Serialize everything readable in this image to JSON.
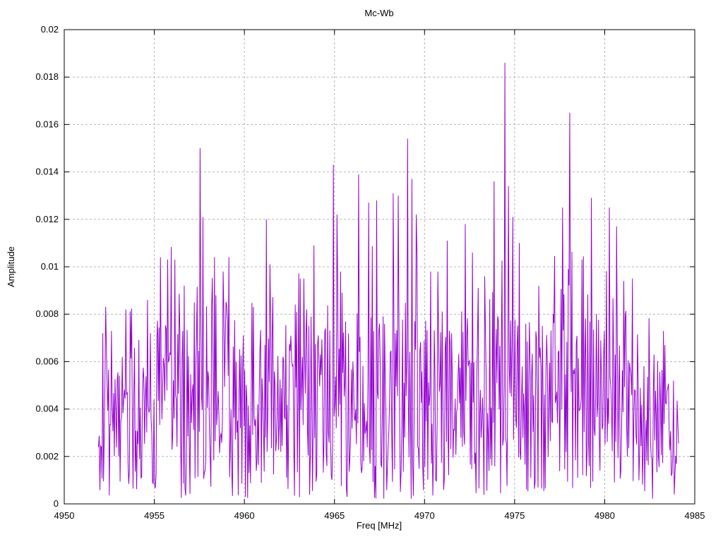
{
  "window": {
    "background": "#ffffff"
  },
  "chart_data": {
    "type": "line",
    "title": "Mc-Wb",
    "xlabel": "Freq [MHz]",
    "ylabel": "Amplitude",
    "xlim": [
      4950,
      4985
    ],
    "ylim": [
      0,
      0.02
    ],
    "x_ticks": [
      4950,
      4955,
      4960,
      4965,
      4970,
      4975,
      4980,
      4985
    ],
    "x_tick_labels": [
      "4950",
      "4955",
      "4960",
      "4965",
      "4970",
      "4975",
      "4980",
      "4985"
    ],
    "y_ticks": [
      0,
      0.002,
      0.004,
      0.006,
      0.008,
      0.01,
      0.012,
      0.014,
      0.016,
      0.018,
      0.02
    ],
    "y_tick_labels": [
      "0",
      "0.002",
      "0.004",
      "0.006",
      "0.008",
      "0.01",
      "0.012",
      "0.014",
      "0.016",
      "0.018",
      "0.02"
    ],
    "grid": "dashed",
    "grid_color": "#b5b5b5",
    "axis_color": "#000000",
    "legend": "none",
    "series": [
      {
        "name": "Mc-Wb",
        "color": "#9400D3",
        "style": "lines",
        "x_start": 4951.9,
        "x_end": 4984.1,
        "x_step": 0.04,
        "noise_floor": 0.0002,
        "seed": 11,
        "spike_probability": 0.07,
        "spike_gain": 0.3,
        "band_envelope": [
          [
            4951.9,
            0.0045
          ],
          [
            4952.3,
            0.0068
          ],
          [
            4953.0,
            0.006
          ],
          [
            4953.6,
            0.0072
          ],
          [
            4954.5,
            0.007
          ],
          [
            4955.2,
            0.0078
          ],
          [
            4956.0,
            0.0085
          ],
          [
            4957.0,
            0.007
          ],
          [
            4957.8,
            0.0075
          ],
          [
            4958.8,
            0.0085
          ],
          [
            4959.6,
            0.0078
          ],
          [
            4960.4,
            0.0072
          ],
          [
            4961.2,
            0.0078
          ],
          [
            4962.2,
            0.0068
          ],
          [
            4963.0,
            0.0075
          ],
          [
            4964.0,
            0.0082
          ],
          [
            4965.0,
            0.0085
          ],
          [
            4966.0,
            0.0078
          ],
          [
            4967.0,
            0.0085
          ],
          [
            4968.0,
            0.0082
          ],
          [
            4969.0,
            0.0088
          ],
          [
            4970.0,
            0.0078
          ],
          [
            4971.0,
            0.0075
          ],
          [
            4972.0,
            0.0082
          ],
          [
            4973.0,
            0.0078
          ],
          [
            4974.0,
            0.0082
          ],
          [
            4975.0,
            0.0082
          ],
          [
            4976.0,
            0.0078
          ],
          [
            4977.0,
            0.0082
          ],
          [
            4978.0,
            0.0085
          ],
          [
            4979.0,
            0.0082
          ],
          [
            4980.0,
            0.0082
          ],
          [
            4981.0,
            0.0085
          ],
          [
            4982.0,
            0.0078
          ],
          [
            4982.8,
            0.0065
          ],
          [
            4983.4,
            0.0058
          ],
          [
            4983.8,
            0.0045
          ],
          [
            4984.1,
            0.0035
          ]
        ],
        "peaks": [
          [
            4952.15,
            0.0072
          ],
          [
            4953.4,
            0.0082
          ],
          [
            4954.6,
            0.0086
          ],
          [
            4955.35,
            0.0104
          ],
          [
            4955.75,
            0.0103
          ],
          [
            4956.15,
            0.0103
          ],
          [
            4956.65,
            0.0092
          ],
          [
            4957.55,
            0.015
          ],
          [
            4957.7,
            0.0121
          ],
          [
            4958.35,
            0.0104
          ],
          [
            4958.8,
            0.0098
          ],
          [
            4959.15,
            0.0104
          ],
          [
            4960.5,
            0.0083
          ],
          [
            4961.2,
            0.012
          ],
          [
            4961.4,
            0.0101
          ],
          [
            4963.3,
            0.0095
          ],
          [
            4963.85,
            0.0109
          ],
          [
            4964.95,
            0.0143
          ],
          [
            4965.15,
            0.0122
          ],
          [
            4965.35,
            0.0098
          ],
          [
            4966.35,
            0.0139
          ],
          [
            4966.9,
            0.0127
          ],
          [
            4967.35,
            0.0128
          ],
          [
            4968.25,
            0.0131
          ],
          [
            4968.55,
            0.013
          ],
          [
            4969.05,
            0.0154
          ],
          [
            4969.3,
            0.0137
          ],
          [
            4969.55,
            0.0122
          ],
          [
            4970.35,
            0.0098
          ],
          [
            4970.75,
            0.0098
          ],
          [
            4971.25,
            0.0111
          ],
          [
            4972.25,
            0.0118
          ],
          [
            4972.65,
            0.0106
          ],
          [
            4973.35,
            0.0096
          ],
          [
            4973.85,
            0.0136
          ],
          [
            4974.45,
            0.0186
          ],
          [
            4974.65,
            0.0134
          ],
          [
            4974.9,
            0.0121
          ],
          [
            4975.25,
            0.011
          ],
          [
            4976.35,
            0.0092
          ],
          [
            4977.65,
            0.0125
          ],
          [
            4978.05,
            0.0165
          ],
          [
            4978.75,
            0.0103
          ],
          [
            4979.25,
            0.0129
          ],
          [
            4980.25,
            0.0125
          ],
          [
            4980.65,
            0.0117
          ],
          [
            4981.05,
            0.0094
          ],
          [
            4981.55,
            0.0095
          ],
          [
            4983.35,
            0.0067
          ]
        ]
      }
    ]
  }
}
